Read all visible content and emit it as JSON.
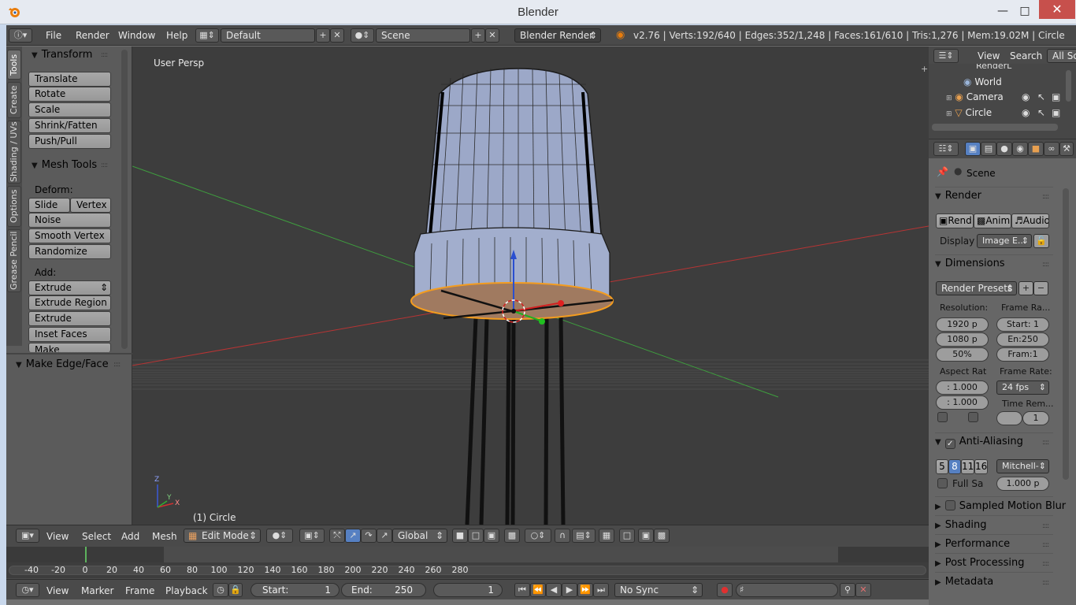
{
  "window": {
    "title": "Blender"
  },
  "info_header": {
    "menus": [
      "File",
      "Render",
      "Window",
      "Help"
    ],
    "screen_layout": "Default",
    "scene": "Scene",
    "render_engine": "Blender Render",
    "stats": "v2.76 | Verts:192/640 | Edges:352/1,248 | Faces:161/610 | Tris:1,276 | Mem:19.02M | Circle"
  },
  "tool_shelf": {
    "tabs": [
      "Tools",
      "Create",
      "Shading / UVs",
      "Options",
      "Grease Pencil"
    ],
    "transform": {
      "title": "Transform",
      "buttons": [
        "Translate",
        "Rotate",
        "Scale",
        "Shrink/Fatten",
        "Push/Pull"
      ]
    },
    "mesh_tools": {
      "title": "Mesh Tools",
      "deform_label": "Deform:",
      "deform": [
        "Slide Ed",
        "Vertex",
        "Noise",
        "Smooth Vertex",
        "Randomize"
      ],
      "add_label": "Add:",
      "add": [
        "Extrude",
        "Extrude Region",
        "Extrude Individual",
        "Inset Faces",
        "Make Edge/Face"
      ]
    },
    "operator_panel": "Make Edge/Face"
  },
  "viewport": {
    "view_name": "User Persp",
    "object_label": "(1) Circle",
    "axis_labels": [
      "Z",
      "Y",
      "X"
    ]
  },
  "view3d_header": {
    "menus": [
      "View",
      "Select",
      "Add",
      "Mesh"
    ],
    "mode": "Edit Mode",
    "orientation": "Global"
  },
  "timeline": {
    "ticks": [
      "-40",
      "-20",
      "0",
      "20",
      "40",
      "60",
      "80",
      "100",
      "120",
      "140",
      "160",
      "180",
      "200",
      "220",
      "240",
      "260",
      "280"
    ],
    "current_frame_marker": 0,
    "menus": [
      "View",
      "Marker",
      "Frame",
      "Playback"
    ],
    "start_label": "Start:",
    "start": "1",
    "end_label": "End:",
    "end": "250",
    "current": "1",
    "sync": "No Sync"
  },
  "outliner": {
    "menus": [
      "View",
      "Search"
    ],
    "filter": "All Sc",
    "items": [
      "RenderL",
      "World",
      "Camera",
      "Circle"
    ]
  },
  "properties": {
    "context": "Scene",
    "render_section": "Render",
    "render_buttons": [
      "Rend",
      "Anim",
      "Audio"
    ],
    "display_label": "Display",
    "display_value": "Image E...",
    "dimensions_section": "Dimensions",
    "render_presets": "Render Presets",
    "resolution_label": "Resolution:",
    "res_x": "1920 p",
    "res_y": "1080 p",
    "res_pct": "50%",
    "frame_range_label": "Frame Ra...",
    "frame_start": "Start: 1",
    "frame_end": "En:250",
    "frame_step": "Fram:1",
    "aspect_label": "Aspect Rat",
    "aspect_x": ": 1.000",
    "aspect_y": ": 1.000",
    "frame_rate_label": "Frame Rate:",
    "frame_rate": "24 fps",
    "time_remap_label": "Time Rem...",
    "time_remap": "1",
    "aa_section": "Anti-Aliasing",
    "aa_samples": [
      "5",
      "8",
      "11",
      "16"
    ],
    "aa_filter": "Mitchell-",
    "full_sample": "Full Sa",
    "filter_size": "1.000 p",
    "collapsed_sections": [
      "Sampled Motion Blur",
      "Shading",
      "Performance",
      "Post Processing",
      "Metadata"
    ]
  },
  "colors": {
    "accent_blue": "#5680c2",
    "selection_orange": "#f39c1f",
    "header_bg": "#4a4a4a",
    "viewport_bg": "#3d3d3d"
  }
}
